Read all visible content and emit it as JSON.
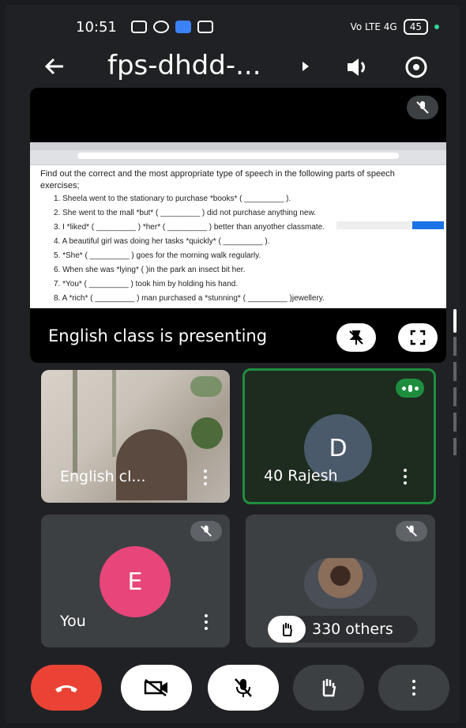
{
  "status_bar": {
    "time": "10:51",
    "signal": "Vo LTE 4G",
    "battery": "45"
  },
  "topbar": {
    "meeting_code": "fps-dhdd-..."
  },
  "presentation": {
    "label": "English class is presenting",
    "worksheet": {
      "intro": "Find out the correct and the most appropriate type of speech in the following parts of speech exercises;",
      "items": [
        "1. Sheela went to the stationary to purchase *books* ( _________ ).",
        "2. She went to the mall *but* ( _________ ) did not purchase anything new.",
        "3. I *liked* ( _________ ) *her* ( _________ ) better than anyother classmate.",
        "4. A beautiful girl was doing her tasks *quickly* ( _________ ).",
        "5. *She* ( _________ ) goes for the morning walk regularly.",
        "6. When she was *lying* ( )in the park an insect bit her.",
        "7. *You* ( _________ ) took him by holding his hand.",
        "8. A *rich* ( _________ ) man purchased a *stunning* ( _________ )jewellery."
      ]
    }
  },
  "tiles": [
    {
      "name": "English cl..."
    },
    {
      "name": "40 Rajesh",
      "initial": "D",
      "avatar_color": "#4a5a6a"
    },
    {
      "name": "You",
      "initial": "E",
      "avatar_color": "#e8457a"
    },
    {
      "name": "330 others"
    }
  ],
  "icons": {
    "back": "arrow-left-icon",
    "speaker": "speaker-icon",
    "flip": "camera-flip-icon",
    "end": "phone-hangup-icon",
    "camera": "camera-off-icon",
    "mic": "mic-off-icon",
    "hand": "raise-hand-icon",
    "more": "more-vert-icon"
  }
}
